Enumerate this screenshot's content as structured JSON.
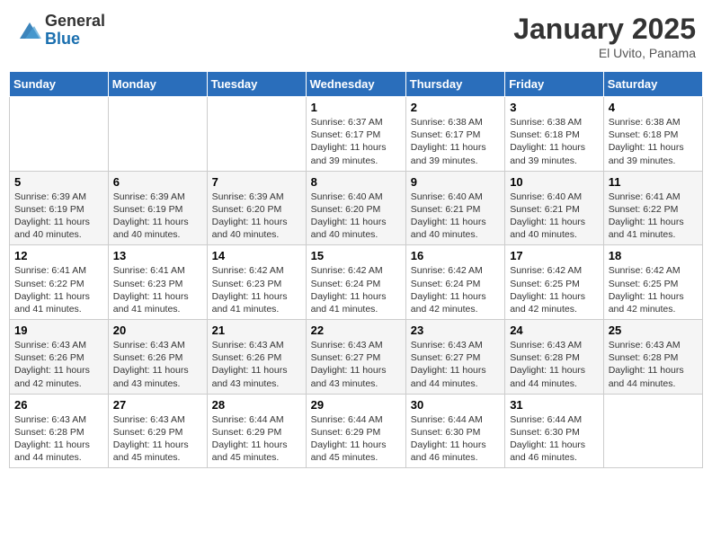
{
  "header": {
    "logo_general": "General",
    "logo_blue": "Blue",
    "title": "January 2025",
    "location": "El Uvito, Panama"
  },
  "weekdays": [
    "Sunday",
    "Monday",
    "Tuesday",
    "Wednesday",
    "Thursday",
    "Friday",
    "Saturday"
  ],
  "weeks": [
    [
      {
        "day": "",
        "info": ""
      },
      {
        "day": "",
        "info": ""
      },
      {
        "day": "",
        "info": ""
      },
      {
        "day": "1",
        "info": "Sunrise: 6:37 AM\nSunset: 6:17 PM\nDaylight: 11 hours and 39 minutes."
      },
      {
        "day": "2",
        "info": "Sunrise: 6:38 AM\nSunset: 6:17 PM\nDaylight: 11 hours and 39 minutes."
      },
      {
        "day": "3",
        "info": "Sunrise: 6:38 AM\nSunset: 6:18 PM\nDaylight: 11 hours and 39 minutes."
      },
      {
        "day": "4",
        "info": "Sunrise: 6:38 AM\nSunset: 6:18 PM\nDaylight: 11 hours and 39 minutes."
      }
    ],
    [
      {
        "day": "5",
        "info": "Sunrise: 6:39 AM\nSunset: 6:19 PM\nDaylight: 11 hours and 40 minutes."
      },
      {
        "day": "6",
        "info": "Sunrise: 6:39 AM\nSunset: 6:19 PM\nDaylight: 11 hours and 40 minutes."
      },
      {
        "day": "7",
        "info": "Sunrise: 6:39 AM\nSunset: 6:20 PM\nDaylight: 11 hours and 40 minutes."
      },
      {
        "day": "8",
        "info": "Sunrise: 6:40 AM\nSunset: 6:20 PM\nDaylight: 11 hours and 40 minutes."
      },
      {
        "day": "9",
        "info": "Sunrise: 6:40 AM\nSunset: 6:21 PM\nDaylight: 11 hours and 40 minutes."
      },
      {
        "day": "10",
        "info": "Sunrise: 6:40 AM\nSunset: 6:21 PM\nDaylight: 11 hours and 40 minutes."
      },
      {
        "day": "11",
        "info": "Sunrise: 6:41 AM\nSunset: 6:22 PM\nDaylight: 11 hours and 41 minutes."
      }
    ],
    [
      {
        "day": "12",
        "info": "Sunrise: 6:41 AM\nSunset: 6:22 PM\nDaylight: 11 hours and 41 minutes."
      },
      {
        "day": "13",
        "info": "Sunrise: 6:41 AM\nSunset: 6:23 PM\nDaylight: 11 hours and 41 minutes."
      },
      {
        "day": "14",
        "info": "Sunrise: 6:42 AM\nSunset: 6:23 PM\nDaylight: 11 hours and 41 minutes."
      },
      {
        "day": "15",
        "info": "Sunrise: 6:42 AM\nSunset: 6:24 PM\nDaylight: 11 hours and 41 minutes."
      },
      {
        "day": "16",
        "info": "Sunrise: 6:42 AM\nSunset: 6:24 PM\nDaylight: 11 hours and 42 minutes."
      },
      {
        "day": "17",
        "info": "Sunrise: 6:42 AM\nSunset: 6:25 PM\nDaylight: 11 hours and 42 minutes."
      },
      {
        "day": "18",
        "info": "Sunrise: 6:42 AM\nSunset: 6:25 PM\nDaylight: 11 hours and 42 minutes."
      }
    ],
    [
      {
        "day": "19",
        "info": "Sunrise: 6:43 AM\nSunset: 6:26 PM\nDaylight: 11 hours and 42 minutes."
      },
      {
        "day": "20",
        "info": "Sunrise: 6:43 AM\nSunset: 6:26 PM\nDaylight: 11 hours and 43 minutes."
      },
      {
        "day": "21",
        "info": "Sunrise: 6:43 AM\nSunset: 6:26 PM\nDaylight: 11 hours and 43 minutes."
      },
      {
        "day": "22",
        "info": "Sunrise: 6:43 AM\nSunset: 6:27 PM\nDaylight: 11 hours and 43 minutes."
      },
      {
        "day": "23",
        "info": "Sunrise: 6:43 AM\nSunset: 6:27 PM\nDaylight: 11 hours and 44 minutes."
      },
      {
        "day": "24",
        "info": "Sunrise: 6:43 AM\nSunset: 6:28 PM\nDaylight: 11 hours and 44 minutes."
      },
      {
        "day": "25",
        "info": "Sunrise: 6:43 AM\nSunset: 6:28 PM\nDaylight: 11 hours and 44 minutes."
      }
    ],
    [
      {
        "day": "26",
        "info": "Sunrise: 6:43 AM\nSunset: 6:28 PM\nDaylight: 11 hours and 44 minutes."
      },
      {
        "day": "27",
        "info": "Sunrise: 6:43 AM\nSunset: 6:29 PM\nDaylight: 11 hours and 45 minutes."
      },
      {
        "day": "28",
        "info": "Sunrise: 6:44 AM\nSunset: 6:29 PM\nDaylight: 11 hours and 45 minutes."
      },
      {
        "day": "29",
        "info": "Sunrise: 6:44 AM\nSunset: 6:29 PM\nDaylight: 11 hours and 45 minutes."
      },
      {
        "day": "30",
        "info": "Sunrise: 6:44 AM\nSunset: 6:30 PM\nDaylight: 11 hours and 46 minutes."
      },
      {
        "day": "31",
        "info": "Sunrise: 6:44 AM\nSunset: 6:30 PM\nDaylight: 11 hours and 46 minutes."
      },
      {
        "day": "",
        "info": ""
      }
    ]
  ]
}
